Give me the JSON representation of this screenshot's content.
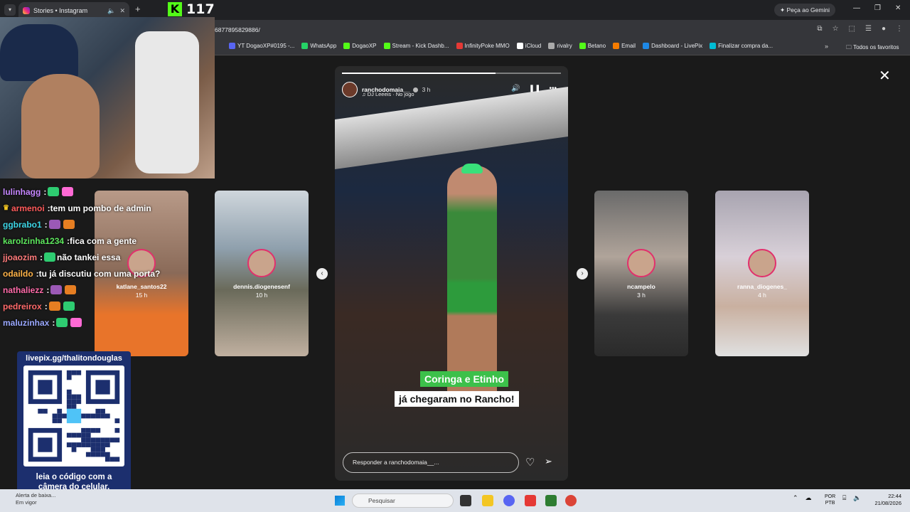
{
  "browser": {
    "tab_title": "Stories • Instagram",
    "url": "6877895829886/",
    "gemini_label": "Peça ao Gemini",
    "bookmarks": [
      "YT DogaoXP#0195 -...",
      "WhatsApp",
      "DogaoXP",
      "Stream - Kick Dashb...",
      "InfinityPoke MMO",
      "iCloud",
      "rivalry",
      "Betano",
      "Email",
      "Dashboard - LivePix",
      "Finalizar compra da..."
    ],
    "bookmarks_folder": "Todos os favoritos"
  },
  "kick": {
    "viewer_count": "117"
  },
  "story": {
    "username": "ranchodomaia__",
    "time": "3 h",
    "music": "DJ Leeeis · No jogo",
    "caption_line1": "Coringa e Etinho",
    "caption_line2": "já chegaram no Rancho!",
    "reply_placeholder": "Responder a ranchodomaia__...",
    "progress": 0.7
  },
  "side_stories": [
    {
      "name": "katlane_santos22",
      "time": "15 h"
    },
    {
      "name": "dennis.diogenesenf",
      "time": "10 h"
    },
    {
      "name": "ncampelo",
      "time": "3 h"
    },
    {
      "name": "ranna_diogenes_",
      "time": "4 h"
    }
  ],
  "chat": [
    {
      "user": "lulinhagg",
      "message": "",
      "color": "#c586ff",
      "emotes": 2,
      "crown": false
    },
    {
      "user": "armenoi",
      "message": "tem um pombo de admin",
      "color": "#ff5a5a",
      "emotes": 0,
      "crown": true
    },
    {
      "user": "ggbrabo1",
      "message": "",
      "color": "#3dd6e6",
      "emotes": 2,
      "crown": false
    },
    {
      "user": "karolzinha1234",
      "message": "fica com a gente",
      "color": "#5ce65c",
      "emotes": 0,
      "crown": false
    },
    {
      "user": "jjoaozim",
      "message": "não tankei essa",
      "color": "#ff7a7a",
      "emotes": 1,
      "crown": false
    },
    {
      "user": "odaildo",
      "message": "tu já discutiu com uma porta?",
      "color": "#ffb347",
      "emotes": 0,
      "crown": false
    },
    {
      "user": "nathaliezz",
      "message": "",
      "color": "#ff6aa8",
      "emotes": 2,
      "crown": false
    },
    {
      "user": "pedreirox",
      "message": "",
      "color": "#ff6a6a",
      "emotes": 2,
      "crown": false
    },
    {
      "user": "maluzinhax",
      "message": "",
      "color": "#9aa8ff",
      "emotes": 2,
      "crown": false
    }
  ],
  "qr": {
    "url": "livepix.gg/thalitondouglas",
    "caption_line1": "leia o código com a",
    "caption_line2": "câmera do celular."
  },
  "taskbar": {
    "alert_title": "Alerta de baixa...",
    "alert_sub": "Em vigor",
    "search_placeholder": "Pesquisar",
    "lang1": "POR",
    "lang2": "PTB",
    "time": "22:44",
    "date": "21/08/2026"
  }
}
